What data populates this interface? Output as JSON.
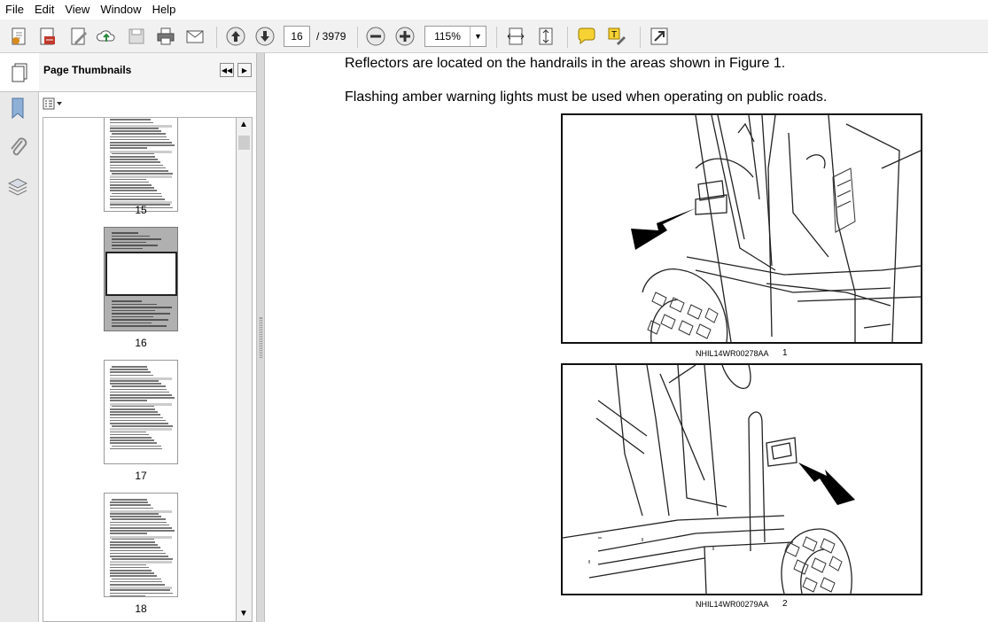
{
  "menu": [
    "File",
    "Edit",
    "View",
    "Window",
    "Help"
  ],
  "toolbar": {
    "current_page": "16",
    "total_pages": "/ 3979",
    "zoom": "115%"
  },
  "panel": {
    "title": "Page Thumbnails",
    "thumbnails": [
      {
        "label": "15"
      },
      {
        "label": "16",
        "selected": true
      },
      {
        "label": "17"
      },
      {
        "label": "18"
      }
    ]
  },
  "document": {
    "line1": "Reflectors are located on the handrails in the areas shown in Figure 1.",
    "line2": "Flashing amber warning lights must be used when operating on public roads.",
    "figures": [
      {
        "code": "NHIL14WR00278AA",
        "number": "1"
      },
      {
        "code": "NHIL14WR00279AA",
        "number": "2"
      }
    ]
  },
  "colors": {
    "selection": "#b0b0b0",
    "toolbar": "#f1f1f1",
    "accent_blue": "#2e6db4"
  }
}
